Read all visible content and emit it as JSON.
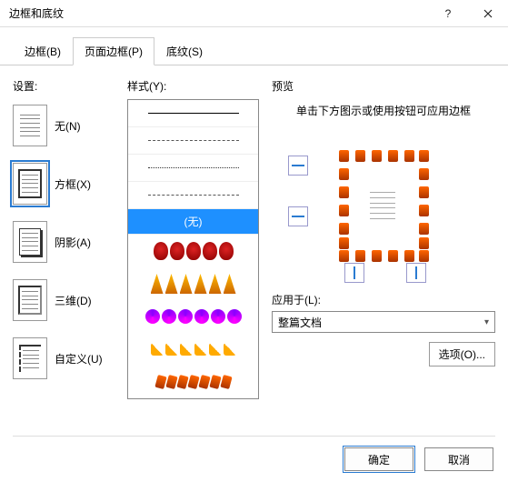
{
  "title": "边框和底纹",
  "tabs": {
    "borders": "边框(B)",
    "page_borders": "页面边框(P)",
    "shading": "底纹(S)"
  },
  "settings": {
    "label": "设置:",
    "none": "无(N)",
    "box": "方框(X)",
    "shadow": "阴影(A)",
    "threed": "三维(D)",
    "custom": "自定义(U)"
  },
  "style": {
    "label": "样式(Y):",
    "none_item": "(无)"
  },
  "preview": {
    "label": "预览",
    "hint": "单击下方图示或使用按钮可应用边框"
  },
  "apply_to": {
    "label": "应用于(L):",
    "value": "整篇文档"
  },
  "options_btn": "选项(O)...",
  "ok": "确定",
  "cancel": "取消"
}
